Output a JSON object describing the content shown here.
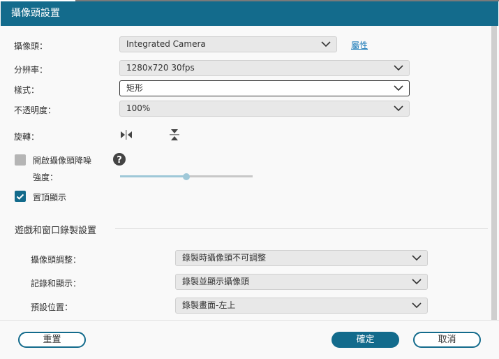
{
  "window": {
    "title": "攝像頭設置"
  },
  "camera": {
    "label": "攝像頭：",
    "value": "Integrated Camera",
    "properties_link": "屬性"
  },
  "resolution": {
    "label": "分辨率：",
    "value": "1280x720 30fps"
  },
  "style": {
    "label": "樣式：",
    "value": "矩形"
  },
  "opacity": {
    "label": "不透明度：",
    "value": "100%"
  },
  "rotate": {
    "label": "旋轉：",
    "icons": [
      "flip-horizontal-icon",
      "flip-vertical-icon"
    ]
  },
  "denoise": {
    "label": "開啟攝像頭降噪",
    "checked": false,
    "strength_label": "強度：",
    "strength_value": 0.5
  },
  "on_top": {
    "label": "置頂顯示",
    "checked": true
  },
  "game_section": {
    "title": "遊戲和窗口錄製設置",
    "rows": [
      {
        "label": "攝像頭調整：",
        "value": "錄製時攝像頭不可調整"
      },
      {
        "label": "記錄和顯示：",
        "value": "錄製並顯示攝像頭"
      },
      {
        "label": "預設位置：",
        "value": "錄製畫面-左上"
      }
    ]
  },
  "footer": {
    "reset": "重置",
    "ok": "確定",
    "cancel": "取消"
  },
  "colors": {
    "accent": "#136b8c",
    "slider": "#9fc8d8",
    "link": "#1a7ab8"
  }
}
